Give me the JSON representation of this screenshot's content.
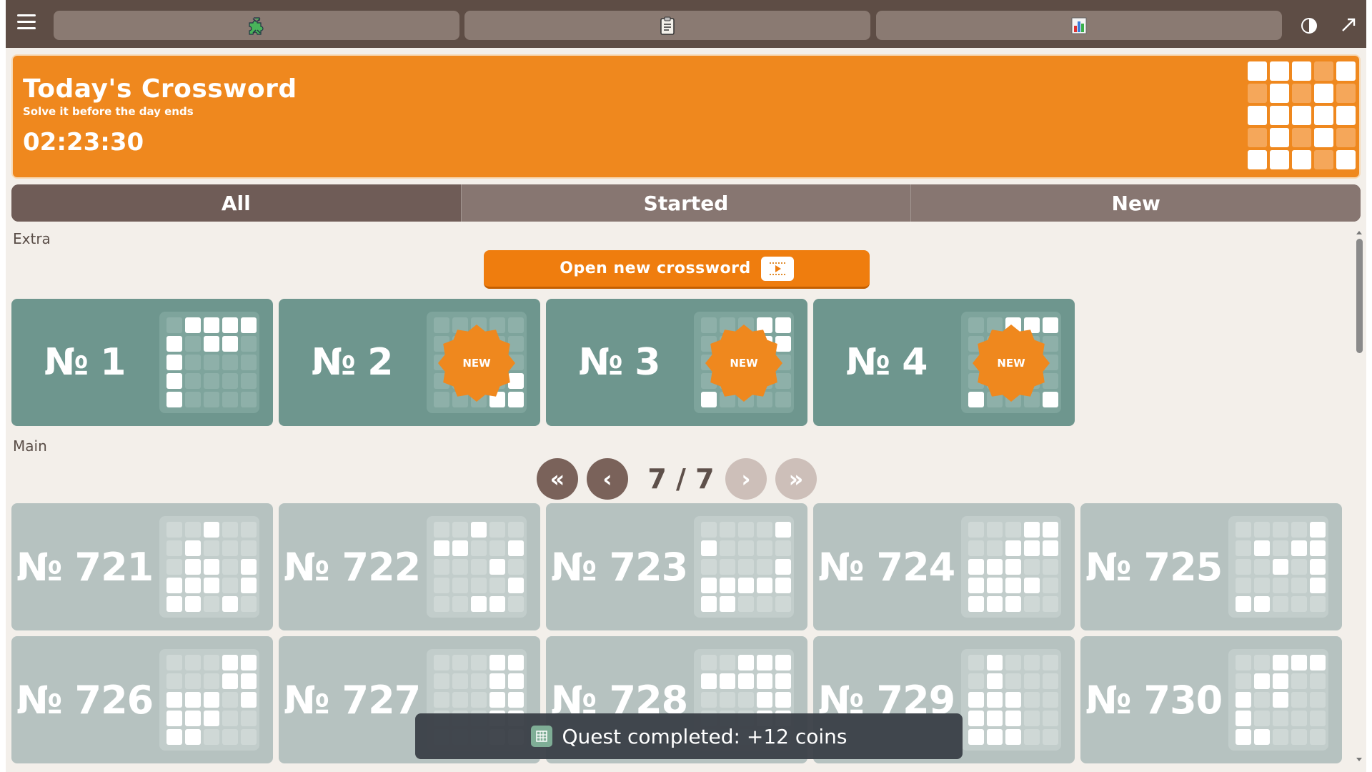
{
  "colors": {
    "topbar": "#5e4d45",
    "banner": "#ef881e",
    "extra_card": "#6e968e",
    "main_card": "#b6c2c0",
    "accent_button": "#ef7d0e",
    "new_badge": "#ef881e"
  },
  "topbar": {
    "menu_icon": "hamburger-icon",
    "tabs": [
      {
        "icon": "puzzle-piece-icon"
      },
      {
        "icon": "clipboard-icon"
      },
      {
        "icon": "bar-chart-icon"
      }
    ],
    "right_icons": [
      "contrast-icon",
      "expand-icon"
    ]
  },
  "banner": {
    "title": "Today's Crossword",
    "subtitle": "Solve it before the day ends",
    "timer": "02:23:30"
  },
  "filter_tabs": [
    {
      "label": "All",
      "active": true
    },
    {
      "label": "Started",
      "active": false
    },
    {
      "label": "New",
      "active": false
    }
  ],
  "extra": {
    "label": "Extra",
    "open_button": "Open new crossword",
    "cards": [
      {
        "label": "№ 1",
        "is_new": false
      },
      {
        "label": "№ 2",
        "is_new": true
      },
      {
        "label": "№ 3",
        "is_new": true
      },
      {
        "label": "№ 4",
        "is_new": true
      }
    ],
    "badge_text": "NEW"
  },
  "main": {
    "label": "Main",
    "pager": {
      "current": "7 / 7",
      "first": "«",
      "prev": "‹",
      "next": "›",
      "last": "»"
    },
    "cards": [
      {
        "label": "№ 721"
      },
      {
        "label": "№ 722"
      },
      {
        "label": "№ 723"
      },
      {
        "label": "№ 724"
      },
      {
        "label": "№ 725"
      },
      {
        "label": "№ 726"
      },
      {
        "label": "№ 727"
      },
      {
        "label": "№ 728"
      },
      {
        "label": "№ 729"
      },
      {
        "label": "№ 730"
      }
    ]
  },
  "toast": {
    "icon": "grid-icon",
    "text": "Quest completed: +12 coins"
  }
}
